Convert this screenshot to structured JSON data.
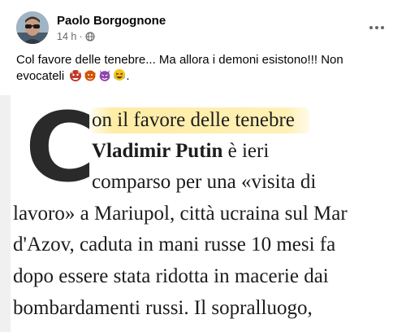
{
  "post": {
    "author": "Paolo Borgognone",
    "time": "14 h",
    "separator": "·",
    "text": "Col favore delle tenebre... Ma allora i demoni esistono!!! Non evocateli",
    "emojis": [
      "ogre-emoji",
      "goblin-emoji",
      "devil-emoji",
      "laughing-emoji"
    ],
    "trailing": "."
  },
  "article": {
    "dropcap": "C",
    "line1": "on il favore delle tenebre",
    "line2_bold": "Vladimir Putin",
    "line2_rest": " è ieri",
    "line3": "comparso per una «visita di",
    "line4": "lavoro» a Mariupol, città ucraina sul Mar",
    "line5": "d'Azov, caduta in mani russe 10 mesi fa",
    "line6": "dopo essere stata ridotta in macerie dai",
    "line7": "bombardamenti russi. Il sopralluogo,"
  },
  "colors": {
    "text": "#050505",
    "meta": "#65676b",
    "highlight": "#ffeca0"
  }
}
